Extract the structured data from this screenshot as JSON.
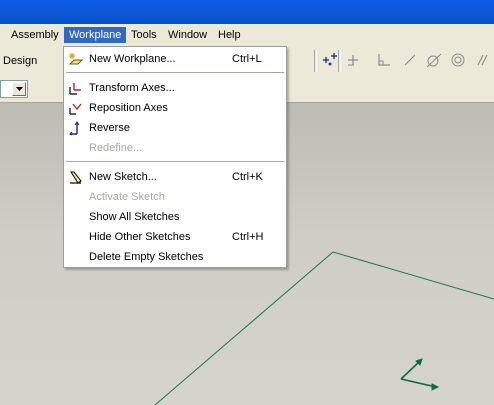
{
  "menubar": {
    "items": [
      {
        "label": "Assembly"
      },
      {
        "label": "Workplane"
      },
      {
        "label": "Tools"
      },
      {
        "label": "Window"
      },
      {
        "label": "Help"
      }
    ]
  },
  "toolbar": {
    "tab_label": "Design"
  },
  "workplane_menu": {
    "items": [
      {
        "label": "New Workplane...",
        "shortcut": "Ctrl+L",
        "enabled": true,
        "icon": "new-workplane-icon"
      },
      {
        "label": "Transform Axes...",
        "shortcut": "",
        "enabled": true,
        "icon": "transform-axes-icon"
      },
      {
        "label": "Reposition Axes",
        "shortcut": "",
        "enabled": true,
        "icon": "reposition-axes-icon"
      },
      {
        "label": "Reverse",
        "shortcut": "",
        "enabled": true,
        "icon": "reverse-icon"
      },
      {
        "label": "Redefine...",
        "shortcut": "",
        "enabled": false,
        "icon": ""
      },
      {
        "label": "New Sketch...",
        "shortcut": "Ctrl+K",
        "enabled": true,
        "icon": "new-sketch-icon"
      },
      {
        "label": "Activate Sketch",
        "shortcut": "",
        "enabled": false,
        "icon": ""
      },
      {
        "label": "Show All Sketches",
        "shortcut": "",
        "enabled": true,
        "icon": ""
      },
      {
        "label": "Hide Other Sketches",
        "shortcut": "Ctrl+H",
        "enabled": true,
        "icon": ""
      },
      {
        "label": "Delete Empty Sketches",
        "shortcut": "",
        "enabled": true,
        "icon": ""
      }
    ]
  },
  "colors": {
    "menu_highlight": "#316ac5",
    "sketch_line": "#1a7a50",
    "axis_green": "#0a6e3c"
  }
}
